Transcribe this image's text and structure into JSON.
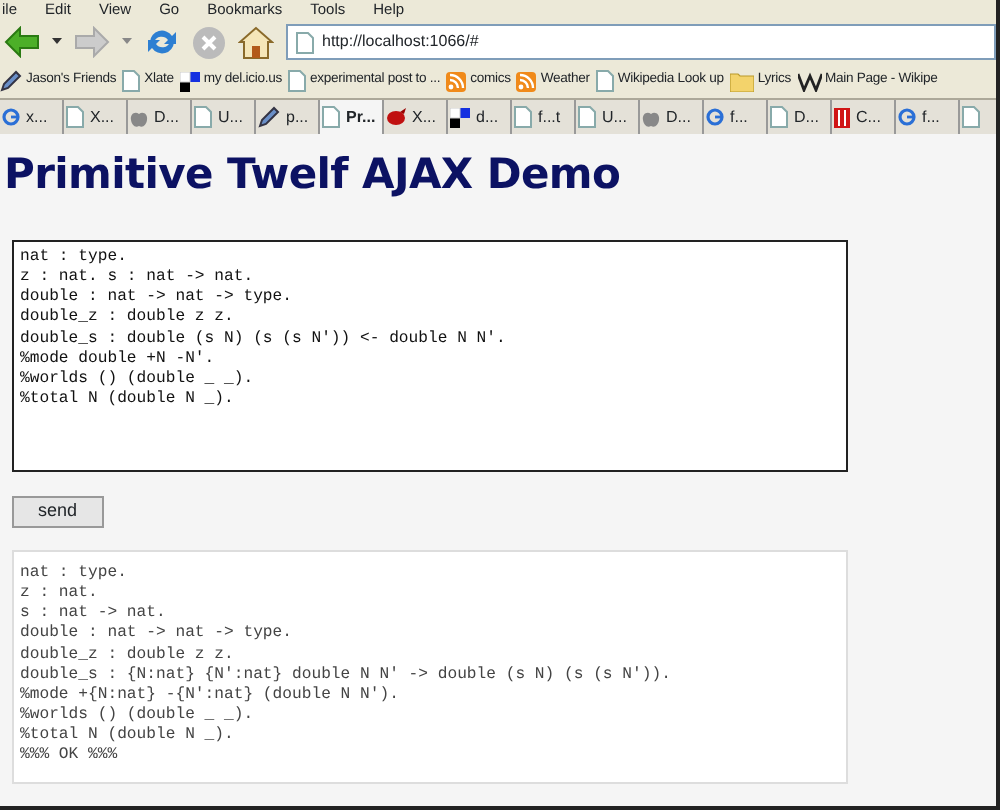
{
  "menu_bar": [
    "ile",
    "Edit",
    "View",
    "Go",
    "Bookmarks",
    "Tools",
    "Help"
  ],
  "toolbar": {
    "address": "http://localhost:1066/#"
  },
  "bookmarks": [
    {
      "label": "Jason's Friends",
      "kind": "pencil"
    },
    {
      "label": "Xlate",
      "kind": "page"
    },
    {
      "label": "my del.icio.us",
      "kind": "squares"
    },
    {
      "label": "experimental post to ...",
      "kind": "page"
    },
    {
      "label": "comics",
      "kind": "feed"
    },
    {
      "label": "Weather",
      "kind": "feed"
    },
    {
      "label": "Wikipedia Look up",
      "kind": "page"
    },
    {
      "label": "Lyrics",
      "kind": "folder"
    },
    {
      "label": "Main Page - Wikipe",
      "kind": "w"
    }
  ],
  "tabs": [
    {
      "label": "x...",
      "kind": "g",
      "selected": false
    },
    {
      "label": "X...",
      "kind": "page",
      "selected": false
    },
    {
      "label": "D...",
      "kind": "apple",
      "selected": false
    },
    {
      "label": "U...",
      "kind": "page",
      "selected": false
    },
    {
      "label": "p...",
      "kind": "pencil",
      "selected": false
    },
    {
      "label": "Pr...",
      "kind": "page",
      "selected": true
    },
    {
      "label": "X...",
      "kind": "bird",
      "selected": false
    },
    {
      "label": "d...",
      "kind": "squares",
      "selected": false
    },
    {
      "label": "f...t",
      "kind": "page",
      "selected": false
    },
    {
      "label": "U...",
      "kind": "page",
      "selected": false
    },
    {
      "label": "D...",
      "kind": "apple",
      "selected": false
    },
    {
      "label": "f...",
      "kind": "g",
      "selected": false
    },
    {
      "label": "D...",
      "kind": "page",
      "selected": false
    },
    {
      "label": "C...",
      "kind": "red",
      "selected": false
    },
    {
      "label": "f...",
      "kind": "g",
      "selected": false
    }
  ],
  "page": {
    "heading": "Primitive Twelf AJAX Demo",
    "input": [
      "nat : type.",
      "z : nat. s : nat -> nat.",
      "double : nat -> nat -> type.",
      "double_z : double z z.",
      "double_s : double (s N) (s (s N')) <- double N N'.",
      "%mode double +N -N'.",
      "%worlds () (double _ _).",
      "%total N (double N _)."
    ],
    "button": "send",
    "output": [
      "nat : type.",
      "z : nat.",
      "s : nat -> nat.",
      "double : nat -> nat -> type.",
      "double_z : double z z.",
      "double_s : {N:nat} {N':nat} double N N' -> double (s N) (s (s N')).",
      "%mode +{N:nat} -{N':nat} (double N N').",
      "%worlds () (double _ _).",
      "%total N (double N _).",
      "%%% OK %%%"
    ]
  }
}
